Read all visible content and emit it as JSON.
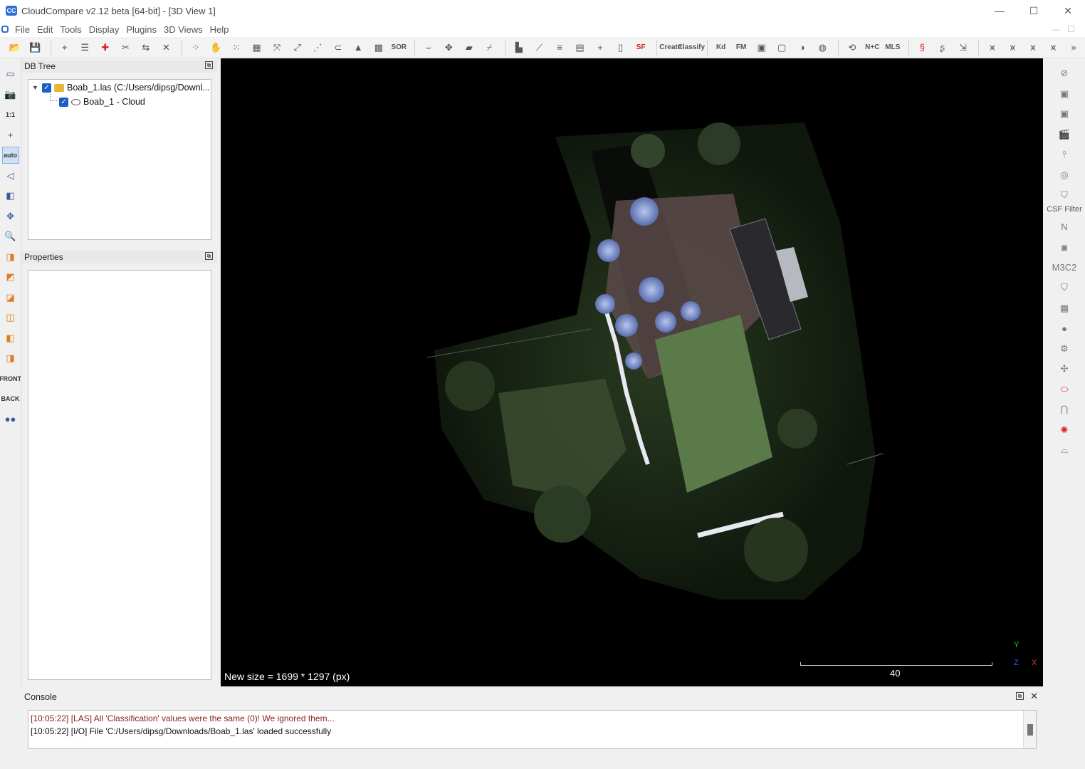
{
  "window": {
    "title": "CloudCompare v2.12 beta [64-bit] - [3D View 1]",
    "logo_text": "CC",
    "controls": [
      "—",
      "☐",
      "✕"
    ]
  },
  "menu": {
    "items": [
      "File",
      "Edit",
      "Tools",
      "Display",
      "Plugins",
      "3D Views",
      "Help"
    ],
    "right_controls": [
      "—",
      "☐"
    ]
  },
  "toolbar": {
    "text_buttons": {
      "sor": "SOR",
      "sf": "SF",
      "kd": "Kd",
      "fm": "FM",
      "nc": "N+C",
      "mls": "MLS",
      "canupo_create": "Create",
      "canupo_classify": "Classify"
    }
  },
  "left_toolbar": {
    "one_to_one": "1:1",
    "auto": "auto",
    "front": "FRONT",
    "back": "BACK"
  },
  "db_tree": {
    "title": "DB Tree",
    "items": [
      {
        "label": "Boab_1.las (C:/Users/dipsg/Downl..."
      },
      {
        "label": "Boab_1 - Cloud"
      }
    ]
  },
  "properties": {
    "title": "Properties"
  },
  "view3d": {
    "message": "New size = 1699 * 1297 (px)",
    "scale_label": "40",
    "axes": {
      "x": "X",
      "y": "Y",
      "z": "Z"
    }
  },
  "right_toolbar": {
    "csf_label": "CSF Filter",
    "north_label": "N",
    "m3c2_label": "M3C2"
  },
  "console": {
    "title": "Console",
    "lines": [
      {
        "text": "[10:05:22] [LAS] All 'Classification' values were the same (0)! We ignored them...",
        "level": "warning"
      },
      {
        "text": "[10:05:22] [I/O] File 'C:/Users/dipsg/Downloads/Boab_1.las' loaded successfully",
        "level": "info"
      }
    ]
  },
  "colors": {
    "view_background": "#000000",
    "warning_text": "#8b1a1a",
    "checkbox": "#1a5fc8"
  }
}
